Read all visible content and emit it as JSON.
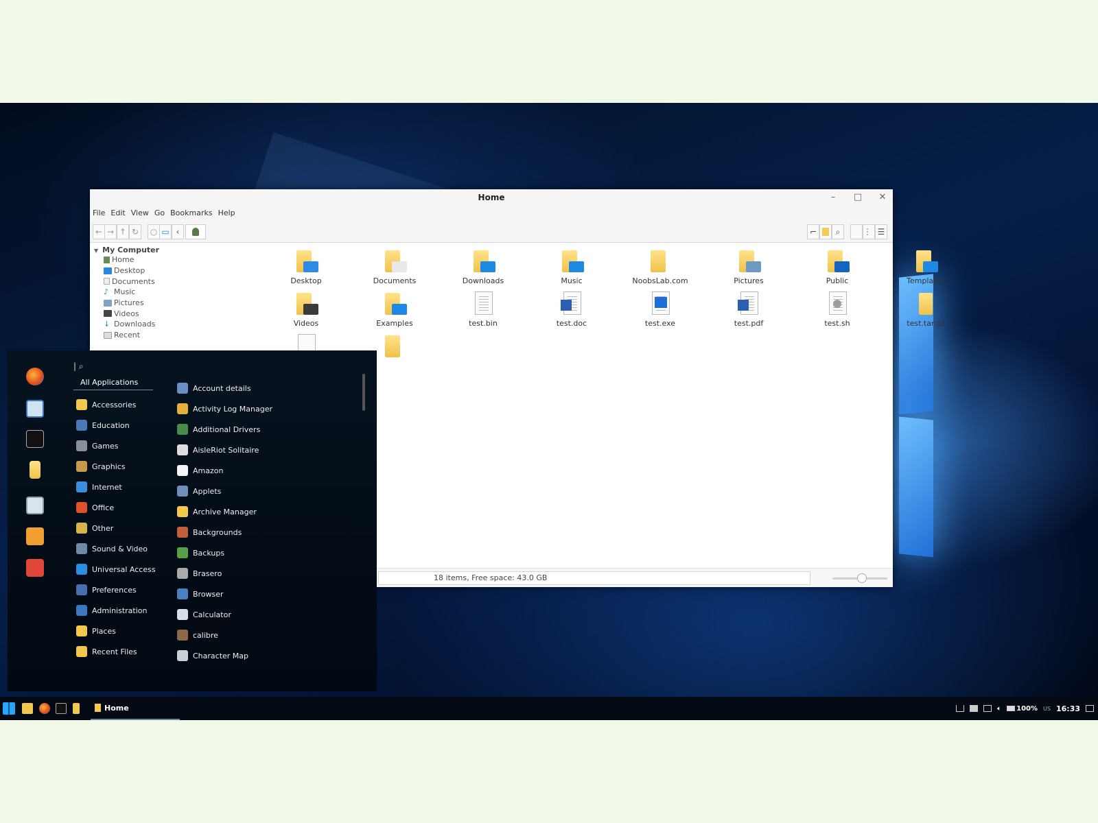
{
  "window": {
    "title": "Home",
    "menu": [
      "File",
      "Edit",
      "View",
      "Go",
      "Bookmarks",
      "Help"
    ]
  },
  "sidebar": {
    "section": "My Computer",
    "items": [
      "Home",
      "Desktop",
      "Documents",
      "Music",
      "Pictures",
      "Videos",
      "Downloads",
      "Recent"
    ]
  },
  "files": [
    {
      "name": "Desktop",
      "kind": "folder",
      "badge": "#2e8ae6"
    },
    {
      "name": "Documents",
      "kind": "folder",
      "badge": "#e8e8e8"
    },
    {
      "name": "Downloads",
      "kind": "folder",
      "badge": "#1e88e5"
    },
    {
      "name": "Music",
      "kind": "folder",
      "badge": "#1e88e5"
    },
    {
      "name": "NoobsLab.com",
      "kind": "folder",
      "badge": ""
    },
    {
      "name": "Pictures",
      "kind": "folder",
      "badge": "#6a9ac2"
    },
    {
      "name": "Public",
      "kind": "folder",
      "badge": "#1565c0"
    },
    {
      "name": "Templates",
      "kind": "folder",
      "badge": "#1e88e5"
    },
    {
      "name": "Videos",
      "kind": "folder",
      "badge": "#3a3a3a"
    },
    {
      "name": "Examples",
      "kind": "folder",
      "badge": "#1e88e5"
    },
    {
      "name": "test.bin",
      "kind": "doc",
      "badge": ""
    },
    {
      "name": "test.doc",
      "kind": "word",
      "badge": "#2b5fb3"
    },
    {
      "name": "test.exe",
      "kind": "exe",
      "badge": "#1e6fd8"
    },
    {
      "name": "test.pdf",
      "kind": "word",
      "badge": "#2b5fb3"
    },
    {
      "name": "test.sh",
      "kind": "script",
      "badge": "#9e9e9e"
    },
    {
      "name": "test.tar.gz",
      "kind": "archive",
      "badge": "#caa84a"
    }
  ],
  "status": "18 items, Free space: 43.0 GB",
  "start_menu": {
    "all_label": "All Applications",
    "categories": [
      "Accessories",
      "Education",
      "Games",
      "Graphics",
      "Internet",
      "Office",
      "Other",
      "Sound & Video",
      "Universal Access",
      "Preferences",
      "Administration",
      "Places",
      "Recent Files"
    ],
    "apps": [
      "Account details",
      "Activity Log Manager",
      "Additional Drivers",
      "AisleRiot Solitaire",
      "Amazon",
      "Applets",
      "Archive Manager",
      "Backgrounds",
      "Backups",
      "Brasero",
      "Browser",
      "Calculator",
      "calibre",
      "Character Map"
    ]
  },
  "taskbar": {
    "task_label": "Home",
    "battery": "100%",
    "layout": "US",
    "clock": "16:33"
  }
}
